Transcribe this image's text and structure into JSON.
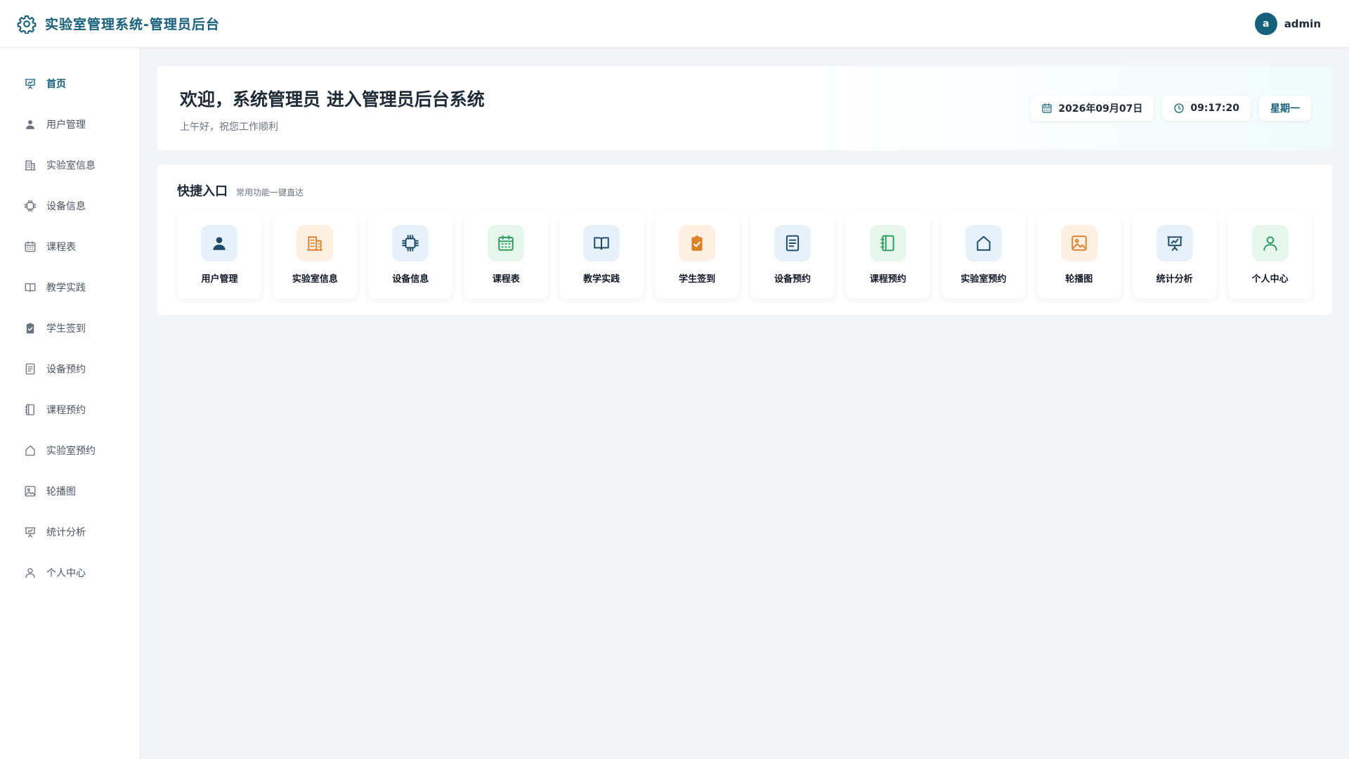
{
  "header": {
    "title": "实验室管理系统-管理员后台",
    "brand_icon": "gear-icon",
    "user": {
      "avatar_letter": "a",
      "name": "admin"
    }
  },
  "sidebar": {
    "items": [
      {
        "label": "首页",
        "icon": "presentation-chart-icon",
        "active": true
      },
      {
        "label": "用户管理",
        "icon": "user-icon"
      },
      {
        "label": "实验室信息",
        "icon": "building-icon"
      },
      {
        "label": "设备信息",
        "icon": "chip-icon"
      },
      {
        "label": "课程表",
        "icon": "calendar-icon"
      },
      {
        "label": "教学实践",
        "icon": "book-open-icon"
      },
      {
        "label": "学生签到",
        "icon": "clipboard-check-icon"
      },
      {
        "label": "设备预约",
        "icon": "document-icon"
      },
      {
        "label": "课程预约",
        "icon": "notebook-icon"
      },
      {
        "label": "实验室预约",
        "icon": "home-icon"
      },
      {
        "label": "轮播图",
        "icon": "image-icon"
      },
      {
        "label": "统计分析",
        "icon": "presentation-chart-icon"
      },
      {
        "label": "个人中心",
        "icon": "user-outline-icon"
      }
    ]
  },
  "welcome": {
    "title": "欢迎，系统管理员 进入管理员后台系统",
    "subtitle": "上午好，祝您工作顺利",
    "date": "2026年09月07日",
    "time": "09:17:20",
    "weekday": "星期一"
  },
  "quick": {
    "title": "快捷入口",
    "subtitle": "常用功能一键直达",
    "tiles": [
      {
        "label": "用户管理",
        "icon": "user-icon",
        "color": "#1f4a6b"
      },
      {
        "label": "实验室信息",
        "icon": "building-icon",
        "color": "#d9822b"
      },
      {
        "label": "设备信息",
        "icon": "chip-icon",
        "color": "#1f4a6b"
      },
      {
        "label": "课程表",
        "icon": "calendar-icon",
        "color": "#2a9d5b"
      },
      {
        "label": "教学实践",
        "icon": "book-open-icon",
        "color": "#1f4a6b"
      },
      {
        "label": "学生签到",
        "icon": "clipboard-check-icon",
        "color": "#d9822b"
      },
      {
        "label": "设备预约",
        "icon": "document-icon",
        "color": "#1f4a6b"
      },
      {
        "label": "课程预约",
        "icon": "notebook-icon",
        "color": "#2a9d5b"
      },
      {
        "label": "实验室预约",
        "icon": "home-icon",
        "color": "#1f4a6b"
      },
      {
        "label": "轮播图",
        "icon": "image-icon",
        "color": "#d9822b"
      },
      {
        "label": "统计分析",
        "icon": "presentation-chart-icon",
        "color": "#1f4a6b"
      },
      {
        "label": "个人中心",
        "icon": "user-outline-icon",
        "color": "#2a9d5b"
      }
    ]
  },
  "colors": {
    "brand": "#17607c",
    "background": "#f2f4f7"
  }
}
